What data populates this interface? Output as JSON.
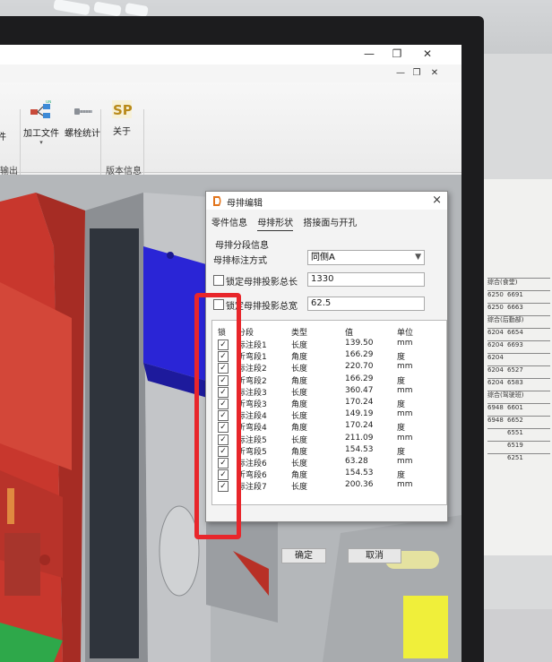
{
  "ribbon": {
    "btn_partial": "件",
    "btn_process_file": "加工文件",
    "btn_bolt_stats": "螺栓统计",
    "btn_about": "关于",
    "group_partial": "输出",
    "group_version": "版本信息",
    "logo_text": "SP"
  },
  "dialog": {
    "title": "母排编辑",
    "close": "×",
    "tabs": [
      "零件信息",
      "母排形状",
      "搭接面与开孔"
    ],
    "section": "母排分段信息",
    "annotation_label": "母排标注方式",
    "annotation_value": "同侧A",
    "lock_length_label": "锁定母排投影总长",
    "lock_length_value": "1330",
    "lock_width_label": "锁定母排投影总宽",
    "lock_width_value": "62.5",
    "columns": [
      "锁",
      "分段",
      "类型",
      "值",
      "单位"
    ],
    "rows": [
      {
        "name": "标注段1",
        "type": "长度",
        "value": "139.50",
        "unit": "mm"
      },
      {
        "name": "折弯段1",
        "type": "角度",
        "value": "166.29",
        "unit": "度"
      },
      {
        "name": "标注段2",
        "type": "长度",
        "value": "220.70",
        "unit": "mm"
      },
      {
        "name": "折弯段2",
        "type": "角度",
        "value": "166.29",
        "unit": "度"
      },
      {
        "name": "标注段3",
        "type": "长度",
        "value": "360.47",
        "unit": "mm"
      },
      {
        "name": "折弯段3",
        "type": "角度",
        "value": "170.24",
        "unit": "度"
      },
      {
        "name": "标注段4",
        "type": "长度",
        "value": "149.19",
        "unit": "mm"
      },
      {
        "name": "折弯段4",
        "type": "角度",
        "value": "170.24",
        "unit": "度"
      },
      {
        "name": "标注段5",
        "type": "长度",
        "value": "211.09",
        "unit": "mm"
      },
      {
        "name": "折弯段5",
        "type": "角度",
        "value": "154.53",
        "unit": "度"
      },
      {
        "name": "标注段6",
        "type": "长度",
        "value": "63.28",
        "unit": "mm"
      },
      {
        "name": "折弯段6",
        "type": "角度",
        "value": "154.53",
        "unit": "度"
      },
      {
        "name": "标注段7",
        "type": "长度",
        "value": "200.36",
        "unit": "mm"
      }
    ],
    "ok": "确定",
    "cancel": "取消"
  },
  "paper_sheet": {
    "rows": [
      [
        "综合(食堂)",
        "",
        ""
      ],
      [
        "6250",
        "6691",
        ""
      ],
      [
        "6250",
        "6663",
        ""
      ],
      [
        "综合(后勤部)",
        "",
        ""
      ],
      [
        "6204",
        "6654",
        ""
      ],
      [
        "6204",
        "6693",
        ""
      ],
      [
        "6204",
        "",
        ""
      ],
      [
        "6204",
        "6527",
        ""
      ],
      [
        "6204",
        "6583",
        ""
      ],
      [
        "综合(驾驶班)",
        "",
        ""
      ],
      [
        "6948",
        "6601",
        ""
      ],
      [
        "6948",
        "6652",
        ""
      ],
      [
        "",
        "6551",
        ""
      ],
      [
        "",
        "6519",
        ""
      ],
      [
        "",
        "6251",
        ""
      ]
    ]
  },
  "colors": {
    "highlight": "#e8262b",
    "model_red": "#c8372d",
    "model_blue": "#2a25d6"
  }
}
